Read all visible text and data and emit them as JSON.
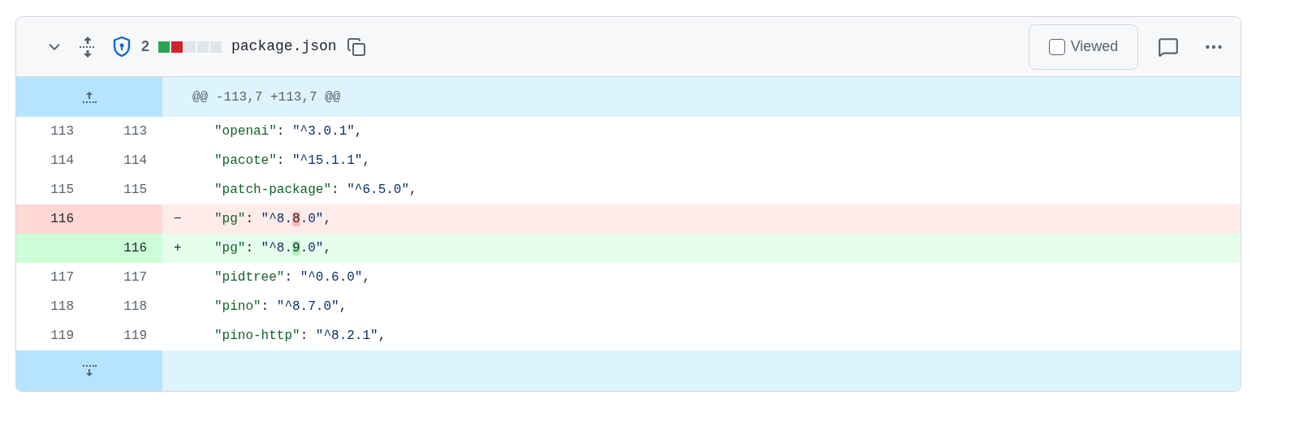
{
  "file": {
    "expanded": true,
    "alert_count": "2",
    "filename": "package.json",
    "viewed": {
      "label": "Viewed",
      "checked": false
    },
    "diffstat": [
      {
        "kind": "added"
      },
      {
        "kind": "deleted"
      },
      {
        "kind": "neutral"
      },
      {
        "kind": "neutral"
      },
      {
        "kind": "neutral"
      }
    ]
  },
  "hunk_header": "@@ -113,7 +113,7 @@",
  "lines": [
    {
      "kind": "context",
      "old": "113",
      "new": "113",
      "tokens": [
        {
          "kind": "key",
          "text": "\"openai\""
        },
        {
          "kind": "punct",
          "text": ": "
        },
        {
          "kind": "string",
          "text": "\"^3.0.1\""
        },
        {
          "kind": "punct",
          "text": ","
        }
      ]
    },
    {
      "kind": "context",
      "old": "114",
      "new": "114",
      "tokens": [
        {
          "kind": "key",
          "text": "\"pacote\""
        },
        {
          "kind": "punct",
          "text": ": "
        },
        {
          "kind": "string",
          "text": "\"^15.1.1\""
        },
        {
          "kind": "punct",
          "text": ","
        }
      ]
    },
    {
      "kind": "context",
      "old": "115",
      "new": "115",
      "tokens": [
        {
          "kind": "key",
          "text": "\"patch-package\""
        },
        {
          "kind": "punct",
          "text": ": "
        },
        {
          "kind": "string",
          "text": "\"^6.5.0\""
        },
        {
          "kind": "punct",
          "text": ","
        }
      ]
    },
    {
      "kind": "deletion",
      "old": "116",
      "sign": "−",
      "tokens": [
        {
          "kind": "key",
          "text": "\"pg\""
        },
        {
          "kind": "punct",
          "text": ": "
        },
        {
          "kind": "string",
          "text": "\"^8."
        },
        {
          "kind": "changed",
          "text": "8"
        },
        {
          "kind": "string",
          "text": ".0\""
        },
        {
          "kind": "punct",
          "text": ","
        }
      ]
    },
    {
      "kind": "addition",
      "new": "116",
      "sign": "+",
      "tokens": [
        {
          "kind": "key",
          "text": "\"pg\""
        },
        {
          "kind": "punct",
          "text": ": "
        },
        {
          "kind": "string",
          "text": "\"^8."
        },
        {
          "kind": "changed",
          "text": "9"
        },
        {
          "kind": "string",
          "text": ".0\""
        },
        {
          "kind": "punct",
          "text": ","
        }
      ]
    },
    {
      "kind": "context",
      "old": "117",
      "new": "117",
      "tokens": [
        {
          "kind": "key",
          "text": "\"pidtree\""
        },
        {
          "kind": "punct",
          "text": ": "
        },
        {
          "kind": "string",
          "text": "\"^0.6.0\""
        },
        {
          "kind": "punct",
          "text": ","
        }
      ]
    },
    {
      "kind": "context",
      "old": "118",
      "new": "118",
      "tokens": [
        {
          "kind": "key",
          "text": "\"pino\""
        },
        {
          "kind": "punct",
          "text": ": "
        },
        {
          "kind": "string",
          "text": "\"^8.7.0\""
        },
        {
          "kind": "punct",
          "text": ","
        }
      ]
    },
    {
      "kind": "context",
      "old": "119",
      "new": "119",
      "tokens": [
        {
          "kind": "key",
          "text": "\"pino-http\""
        },
        {
          "kind": "punct",
          "text": ": "
        },
        {
          "kind": "string",
          "text": "\"^8.2.1\""
        },
        {
          "kind": "punct",
          "text": ","
        }
      ]
    }
  ]
}
